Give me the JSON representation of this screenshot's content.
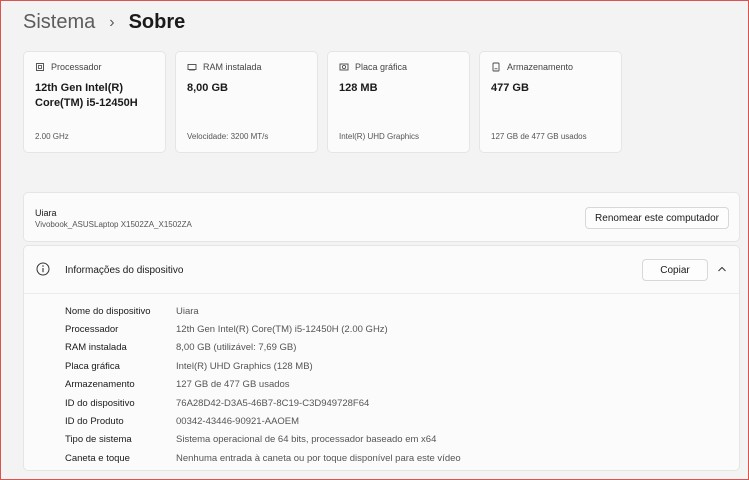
{
  "breadcrumb": {
    "parent": "Sistema",
    "separator": "›",
    "current": "Sobre"
  },
  "cards": [
    {
      "icon": "processor-icon",
      "label": "Processador",
      "value": "12th Gen Intel(R) Core(TM) i5-12450H",
      "sub": "2.00 GHz"
    },
    {
      "icon": "ram-icon",
      "label": "RAM instalada",
      "value": "8,00 GB",
      "sub": "Velocidade: 3200 MT/s"
    },
    {
      "icon": "gpu-icon",
      "label": "Placa gráfica",
      "value": "128 MB",
      "sub": "Intel(R) UHD Graphics"
    },
    {
      "icon": "storage-icon",
      "label": "Armazenamento",
      "value": "477 GB",
      "sub": "127 GB de 477 GB usados"
    }
  ],
  "device": {
    "name": "Uiara",
    "model": "Vivobook_ASUSLaptop X1502ZA_X1502ZA",
    "rename_label": "Renomear este computador"
  },
  "info": {
    "title": "Informações do dispositivo",
    "copy_label": "Copiar",
    "rows": [
      {
        "label": "Nome do dispositivo",
        "value": "Uiara"
      },
      {
        "label": "Processador",
        "value": "12th Gen Intel(R) Core(TM) i5-12450H (2.00 GHz)"
      },
      {
        "label": "RAM instalada",
        "value": "8,00 GB (utilizável: 7,69 GB)"
      },
      {
        "label": "Placa gráfica",
        "value": "Intel(R) UHD Graphics (128 MB)"
      },
      {
        "label": "Armazenamento",
        "value": "127 GB de 477 GB usados"
      },
      {
        "label": "ID do dispositivo",
        "value": "76A28D42-D3A5-46B7-8C19-C3D949728F64"
      },
      {
        "label": "ID do Produto",
        "value": "00342-43446-90921-AAOEM"
      },
      {
        "label": "Tipo de sistema",
        "value": "Sistema operacional de 64 bits, processador baseado em x64"
      },
      {
        "label": "Caneta e toque",
        "value": "Nenhuma entrada à caneta ou por toque disponível para este vídeo"
      }
    ]
  }
}
